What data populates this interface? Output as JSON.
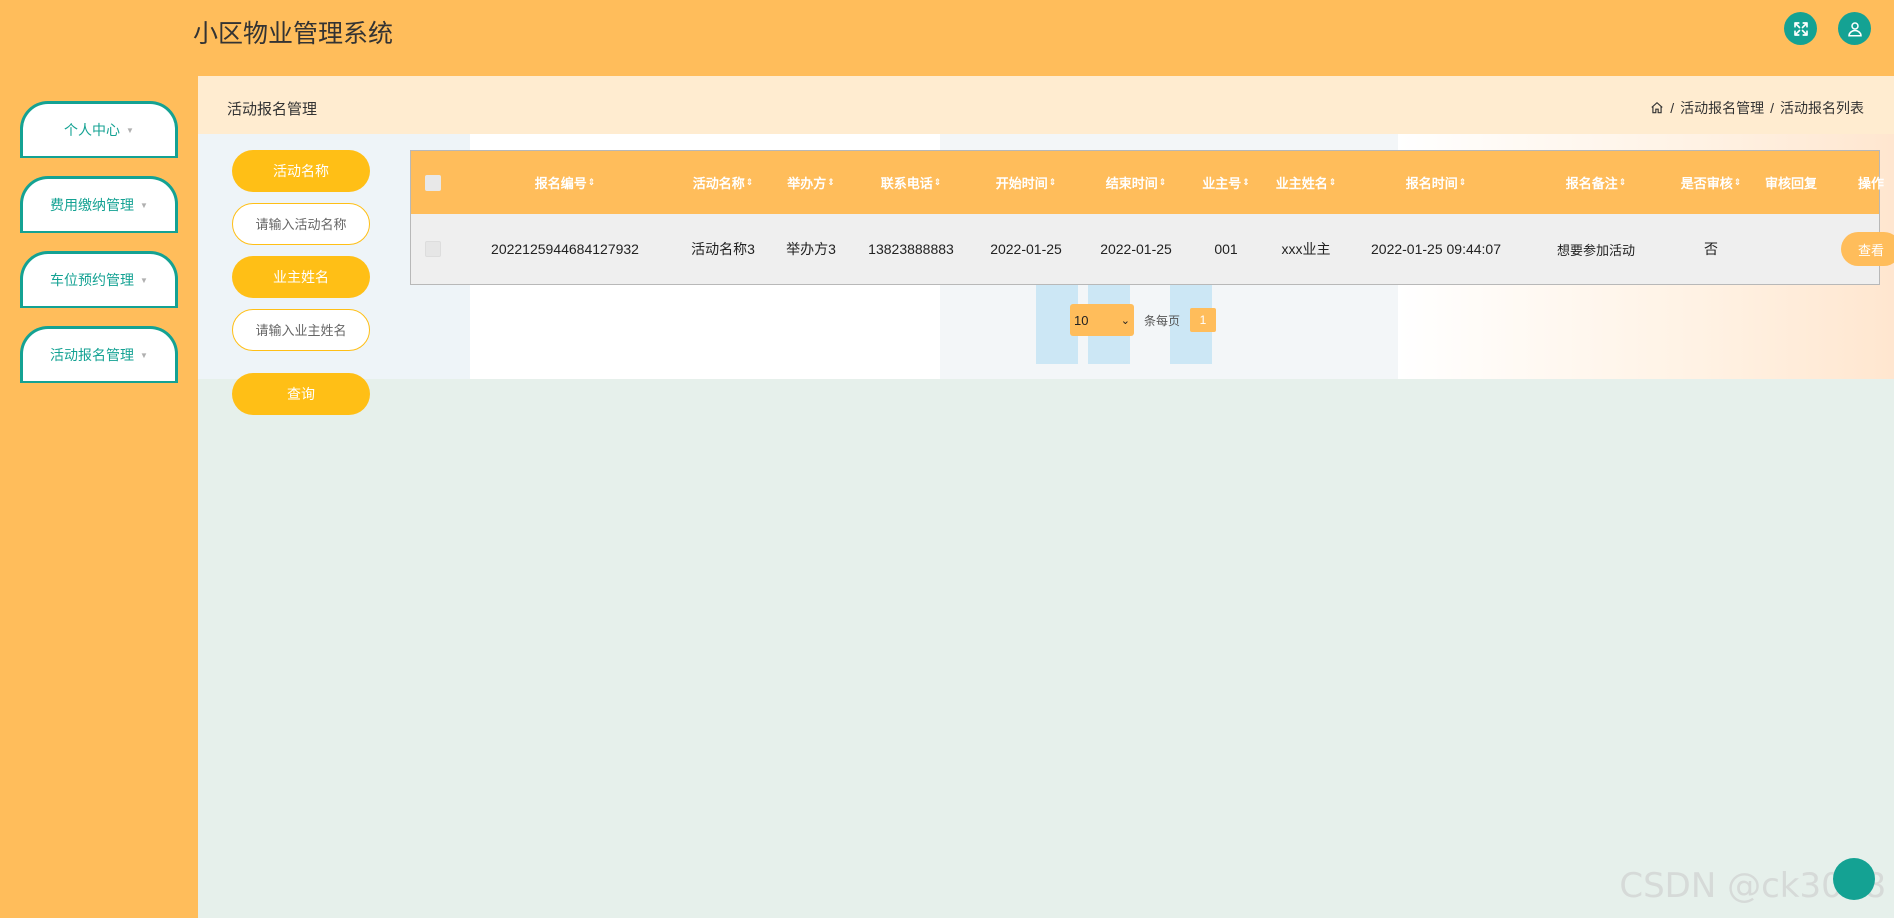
{
  "app": {
    "title": "小区物业管理系统"
  },
  "header_icons": [
    "fullscreen-icon",
    "user-icon"
  ],
  "sidebar": {
    "items": [
      {
        "label": "个人中心"
      },
      {
        "label": "费用缴纳管理"
      },
      {
        "label": "车位预约管理"
      },
      {
        "label": "活动报名管理"
      }
    ]
  },
  "breadcrumb": {
    "title": "活动报名管理",
    "items": [
      "活动报名管理",
      "活动报名列表"
    ],
    "separator": "/"
  },
  "search": {
    "activity_label": "活动名称",
    "activity_placeholder": "请输入活动名称",
    "owner_label": "业主姓名",
    "owner_placeholder": "请输入业主姓名",
    "query_label": "查询"
  },
  "table": {
    "columns": [
      "报名编号",
      "活动名称",
      "举办方",
      "联系电话",
      "开始时间",
      "结束时间",
      "业主号",
      "业主姓名",
      "报名时间",
      "报名备注",
      "是否审核",
      "审核回复",
      "操作"
    ],
    "sort_glyph": "⇕",
    "rows": [
      {
        "cells": [
          "2022125944684127932",
          "活动名称3",
          "举办方3",
          "13823888883",
          "2022-01-25",
          "2022-01-25",
          "001",
          "xxx业主",
          "2022-01-25 09:44:07",
          "想要参加活动",
          "否",
          ""
        ],
        "action": "查看"
      }
    ]
  },
  "pagination": {
    "page_size": "10",
    "page_size_suffix": "条每页",
    "current_page": "1"
  },
  "watermark": "CSDN @ck3018",
  "colors": {
    "accent": "#ffbd5b",
    "teal": "#14a293",
    "button_yellow": "#ffbf16"
  }
}
